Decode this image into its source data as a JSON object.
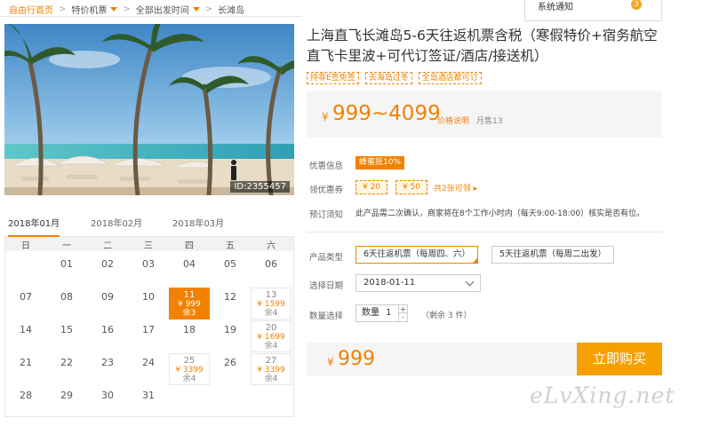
{
  "breadcrumb": {
    "home": "自由行首页",
    "item1": "特价机票",
    "item2": "全部出发时间",
    "item3": "长滩岛",
    "separator": ">"
  },
  "notify": {
    "label": "系统通知",
    "count": "3"
  },
  "photo": {
    "id": "ID:2355457"
  },
  "months": [
    "2018年01月",
    "2018年02月",
    "2018年03月"
  ],
  "calendar": {
    "weekdays": [
      "日",
      "一",
      "二",
      "三",
      "四",
      "五",
      "六"
    ],
    "selected_date": "11",
    "cells": [
      {
        "day": "01"
      },
      {
        "day": "02"
      },
      {
        "day": "03"
      },
      {
        "day": "04"
      },
      {
        "day": "05"
      },
      {
        "day": "06"
      },
      {
        "day": "07"
      },
      {
        "day": "08"
      },
      {
        "day": "09"
      },
      {
        "day": "10"
      },
      {
        "day": "11",
        "price": "¥ 999",
        "left": "余3"
      },
      {
        "day": "12"
      },
      {
        "day": "13",
        "price": "¥ 1599",
        "left": "余4"
      },
      {
        "day": "14"
      },
      {
        "day": "15"
      },
      {
        "day": "16"
      },
      {
        "day": "17"
      },
      {
        "day": "18"
      },
      {
        "day": "19"
      },
      {
        "day": "20",
        "price": "¥ 1699",
        "left": "余4"
      },
      {
        "day": "21"
      },
      {
        "day": "22"
      },
      {
        "day": "23"
      },
      {
        "day": "24"
      },
      {
        "day": "25",
        "price": "¥ 3399",
        "left": "余4"
      },
      {
        "day": "26"
      },
      {
        "day": "27",
        "price": "¥ 3399",
        "left": "余4"
      },
      {
        "day": "28"
      },
      {
        "day": "29"
      },
      {
        "day": "30"
      },
      {
        "day": "31"
      }
    ]
  },
  "product": {
    "title": "上海直飞长滩岛5-6天往返机票含税（寒假特价+宿务航空直飞卡里波+可代订签证/酒店/接送机）",
    "tags": [
      "持菲E签免签",
      "去海岛过冬",
      "全岛酒店都可订"
    ],
    "price_yen": "¥",
    "price_range": "999~4099",
    "price_explain": "价格说明",
    "monthly_sales": "月售13"
  },
  "offers": {
    "promo_label": "优惠信息",
    "promo_badge": "蜂蜜抵10%",
    "coupon_label": "领优惠券",
    "coupons": [
      "¥ 20",
      "¥ 50"
    ],
    "coupon_more": "共2张可领 ▸",
    "notice_label": "预订须知",
    "notice_text": "此产品需二次确认，商家将在8个工作小时内（每天9:00-18:00）核实是否有位。"
  },
  "options": {
    "type_label": "产品类型",
    "types": [
      "6天往返机票（每周四、六）",
      "5天往返机票（每周二出发）"
    ],
    "selected_type": 0,
    "date_label": "选择日期",
    "date_value": "2018-01-11",
    "qty_label": "数量选择",
    "qty_field_label": "数量",
    "qty_value": "1",
    "qty_remaining": "（剩余 3 件）"
  },
  "buy": {
    "yen": "¥",
    "amount": "999",
    "button": "立即购买"
  },
  "watermark": "eLvXing.net",
  "colors": {
    "accent": "#f08200",
    "buy_button": "#f5a000"
  }
}
